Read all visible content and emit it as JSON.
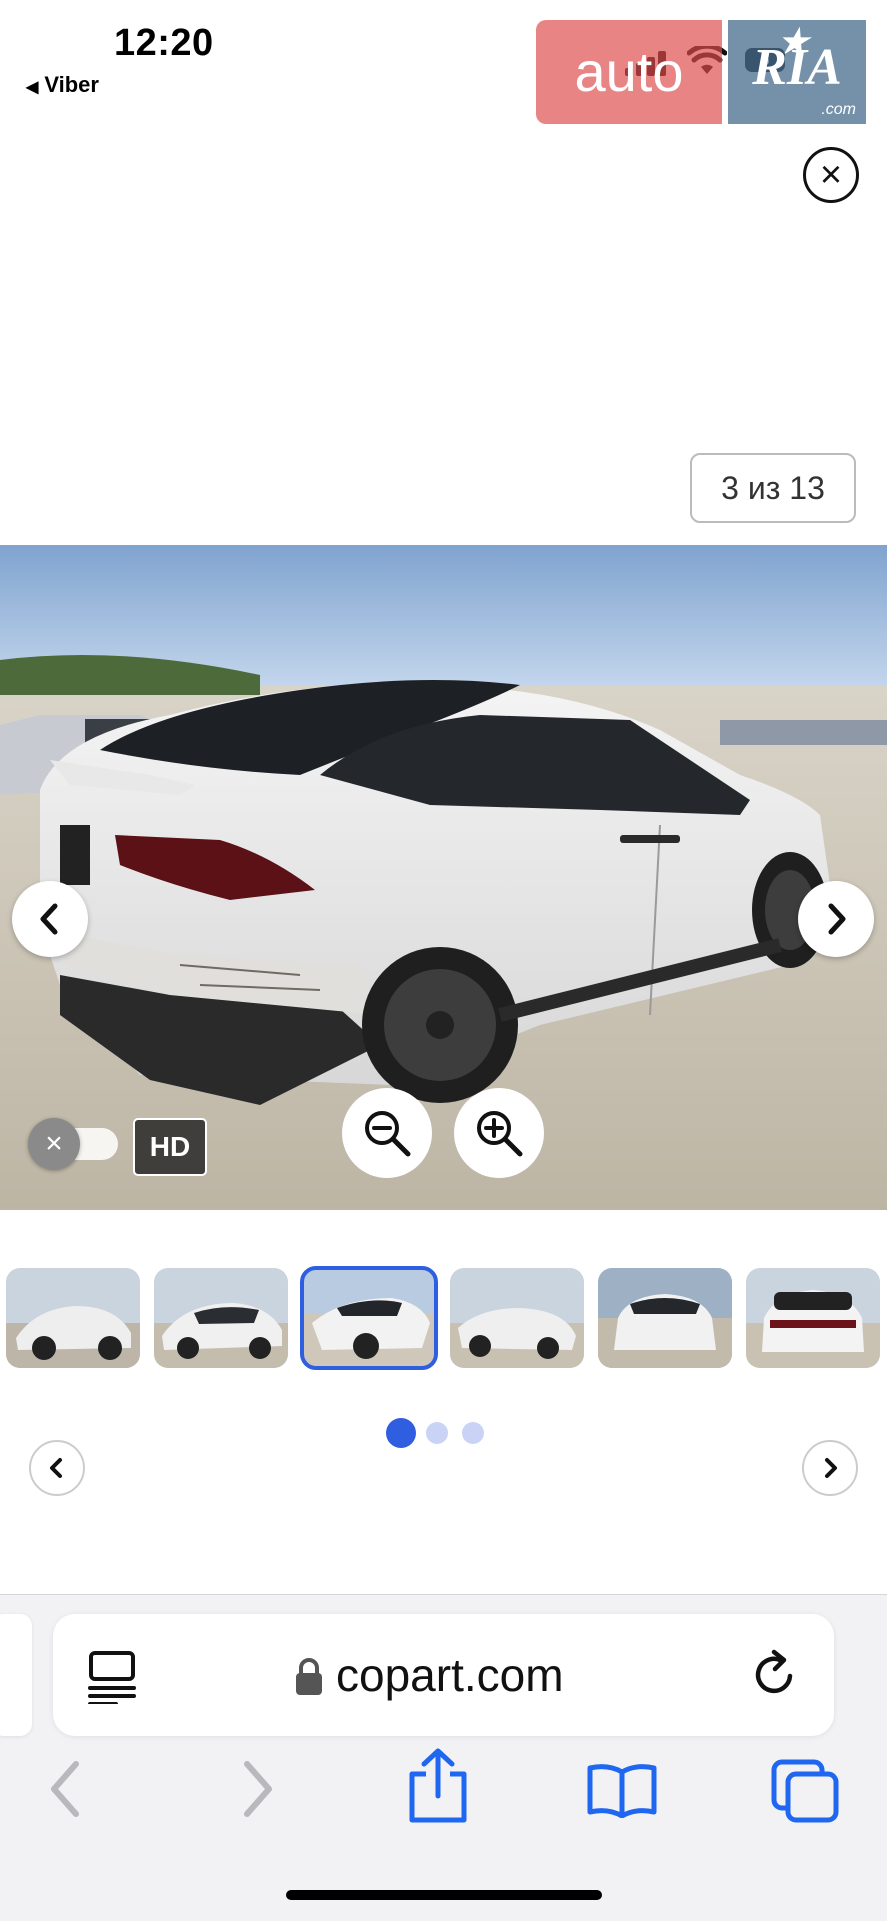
{
  "status_bar": {
    "time": "12:20",
    "back_app": "Viber",
    "battery": "6"
  },
  "watermark": {
    "left_text": "auto",
    "right_text": "RIA",
    "right_suffix": ".com"
  },
  "gallery": {
    "counter": "3 из 13",
    "hd_label": "HD",
    "toggle_on": false,
    "thumbnails_count": 6,
    "active_thumbnail": 3,
    "pager_dots": 3,
    "active_dot": 1
  },
  "browser": {
    "url": "copart.com"
  },
  "colors": {
    "accent": "#2f5fe0",
    "toolbar_icon": "#1f66f0",
    "toolbar_disabled": "#b8b8bd"
  }
}
